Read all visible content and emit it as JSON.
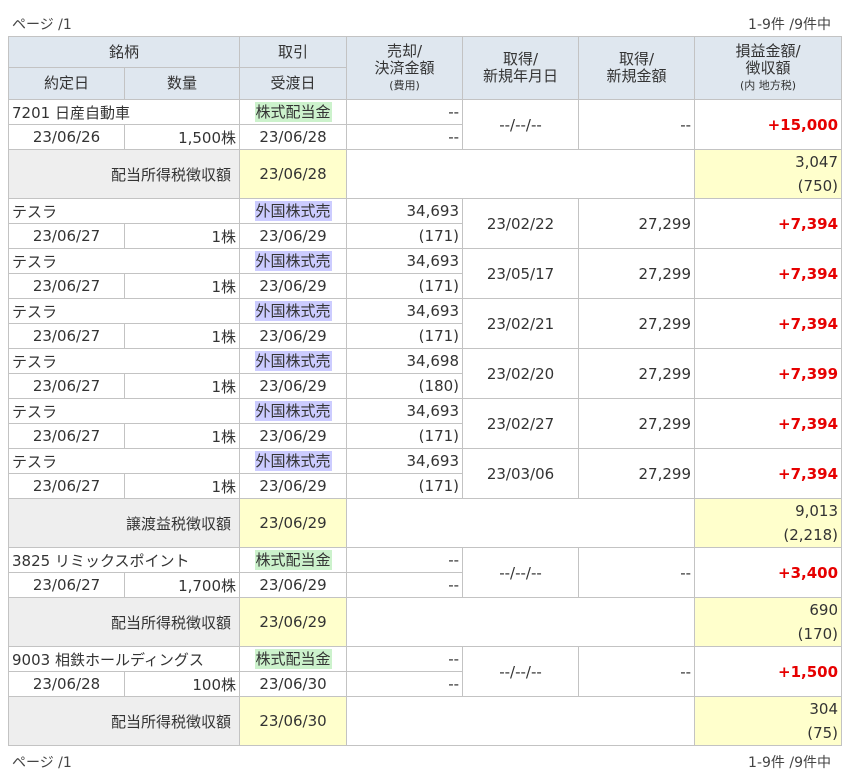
{
  "pager": {
    "page": "ページ /1",
    "count": "1-9件 /9件中"
  },
  "headers": {
    "meigara": "銘柄",
    "torihiki": "取引",
    "baikyaku_line1": "売却/",
    "baikyaku_line2": "決済金額",
    "baikyaku_line3": "(費用)",
    "shutoku_date_line1": "取得/",
    "shutoku_date_line2": "新規年月日",
    "shutoku_amt_line1": "取得/",
    "shutoku_amt_line2": "新規金額",
    "pl_line1": "損益金額/",
    "pl_line2": "徴収額",
    "pl_line3": "(内 地方税)",
    "yakujo": "約定日",
    "suryo": "数量",
    "ukewatashi": "受渡日"
  },
  "rows": [
    {
      "type": "trade",
      "name": "7201 日産自動車",
      "tag": "株式配当金",
      "tag_kind": "div",
      "sell": "--",
      "sell_fee": "--",
      "acq_date": "--/--/--",
      "acq_amt": "--",
      "pl": "+15,000",
      "contract_date": "23/06/26",
      "qty": "1,500株",
      "settle_date": "23/06/28"
    },
    {
      "type": "tax",
      "label": "配当所得税徴収額",
      "date": "23/06/28",
      "amount": "3,047",
      "local": "(750)"
    },
    {
      "type": "trade",
      "name": "テスラ",
      "tag": "外国株式売",
      "tag_kind": "fx",
      "sell": "34,693",
      "sell_fee": "(171)",
      "acq_date": "23/02/22",
      "acq_amt": "27,299",
      "pl": "+7,394",
      "contract_date": "23/06/27",
      "qty": "1株",
      "settle_date": "23/06/29"
    },
    {
      "type": "trade",
      "name": "テスラ",
      "tag": "外国株式売",
      "tag_kind": "fx",
      "sell": "34,693",
      "sell_fee": "(171)",
      "acq_date": "23/05/17",
      "acq_amt": "27,299",
      "pl": "+7,394",
      "contract_date": "23/06/27",
      "qty": "1株",
      "settle_date": "23/06/29"
    },
    {
      "type": "trade",
      "name": "テスラ",
      "tag": "外国株式売",
      "tag_kind": "fx",
      "sell": "34,693",
      "sell_fee": "(171)",
      "acq_date": "23/02/21",
      "acq_amt": "27,299",
      "pl": "+7,394",
      "contract_date": "23/06/27",
      "qty": "1株",
      "settle_date": "23/06/29"
    },
    {
      "type": "trade",
      "name": "テスラ",
      "tag": "外国株式売",
      "tag_kind": "fx",
      "sell": "34,698",
      "sell_fee": "(180)",
      "acq_date": "23/02/20",
      "acq_amt": "27,299",
      "pl": "+7,399",
      "contract_date": "23/06/27",
      "qty": "1株",
      "settle_date": "23/06/29"
    },
    {
      "type": "trade",
      "name": "テスラ",
      "tag": "外国株式売",
      "tag_kind": "fx",
      "sell": "34,693",
      "sell_fee": "(171)",
      "acq_date": "23/02/27",
      "acq_amt": "27,299",
      "pl": "+7,394",
      "contract_date": "23/06/27",
      "qty": "1株",
      "settle_date": "23/06/29"
    },
    {
      "type": "trade",
      "name": "テスラ",
      "tag": "外国株式売",
      "tag_kind": "fx",
      "sell": "34,693",
      "sell_fee": "(171)",
      "acq_date": "23/03/06",
      "acq_amt": "27,299",
      "pl": "+7,394",
      "contract_date": "23/06/27",
      "qty": "1株",
      "settle_date": "23/06/29"
    },
    {
      "type": "tax",
      "label": "譲渡益税徴収額",
      "date": "23/06/29",
      "amount": "9,013",
      "local": "(2,218)"
    },
    {
      "type": "trade",
      "name": "3825 リミックスポイント",
      "tag": "株式配当金",
      "tag_kind": "div",
      "sell": "--",
      "sell_fee": "--",
      "acq_date": "--/--/--",
      "acq_amt": "--",
      "pl": "+3,400",
      "contract_date": "23/06/27",
      "qty": "1,700株",
      "settle_date": "23/06/29"
    },
    {
      "type": "tax",
      "label": "配当所得税徴収額",
      "date": "23/06/29",
      "amount": "690",
      "local": "(170)"
    },
    {
      "type": "trade",
      "name": "9003 相鉄ホールディングス",
      "tag": "株式配当金",
      "tag_kind": "div",
      "sell": "--",
      "sell_fee": "--",
      "acq_date": "--/--/--",
      "acq_amt": "--",
      "pl": "+1,500",
      "contract_date": "23/06/28",
      "qty": "100株",
      "settle_date": "23/06/30"
    },
    {
      "type": "tax",
      "label": "配当所得税徴収額",
      "date": "23/06/30",
      "amount": "304",
      "local": "(75)"
    }
  ]
}
